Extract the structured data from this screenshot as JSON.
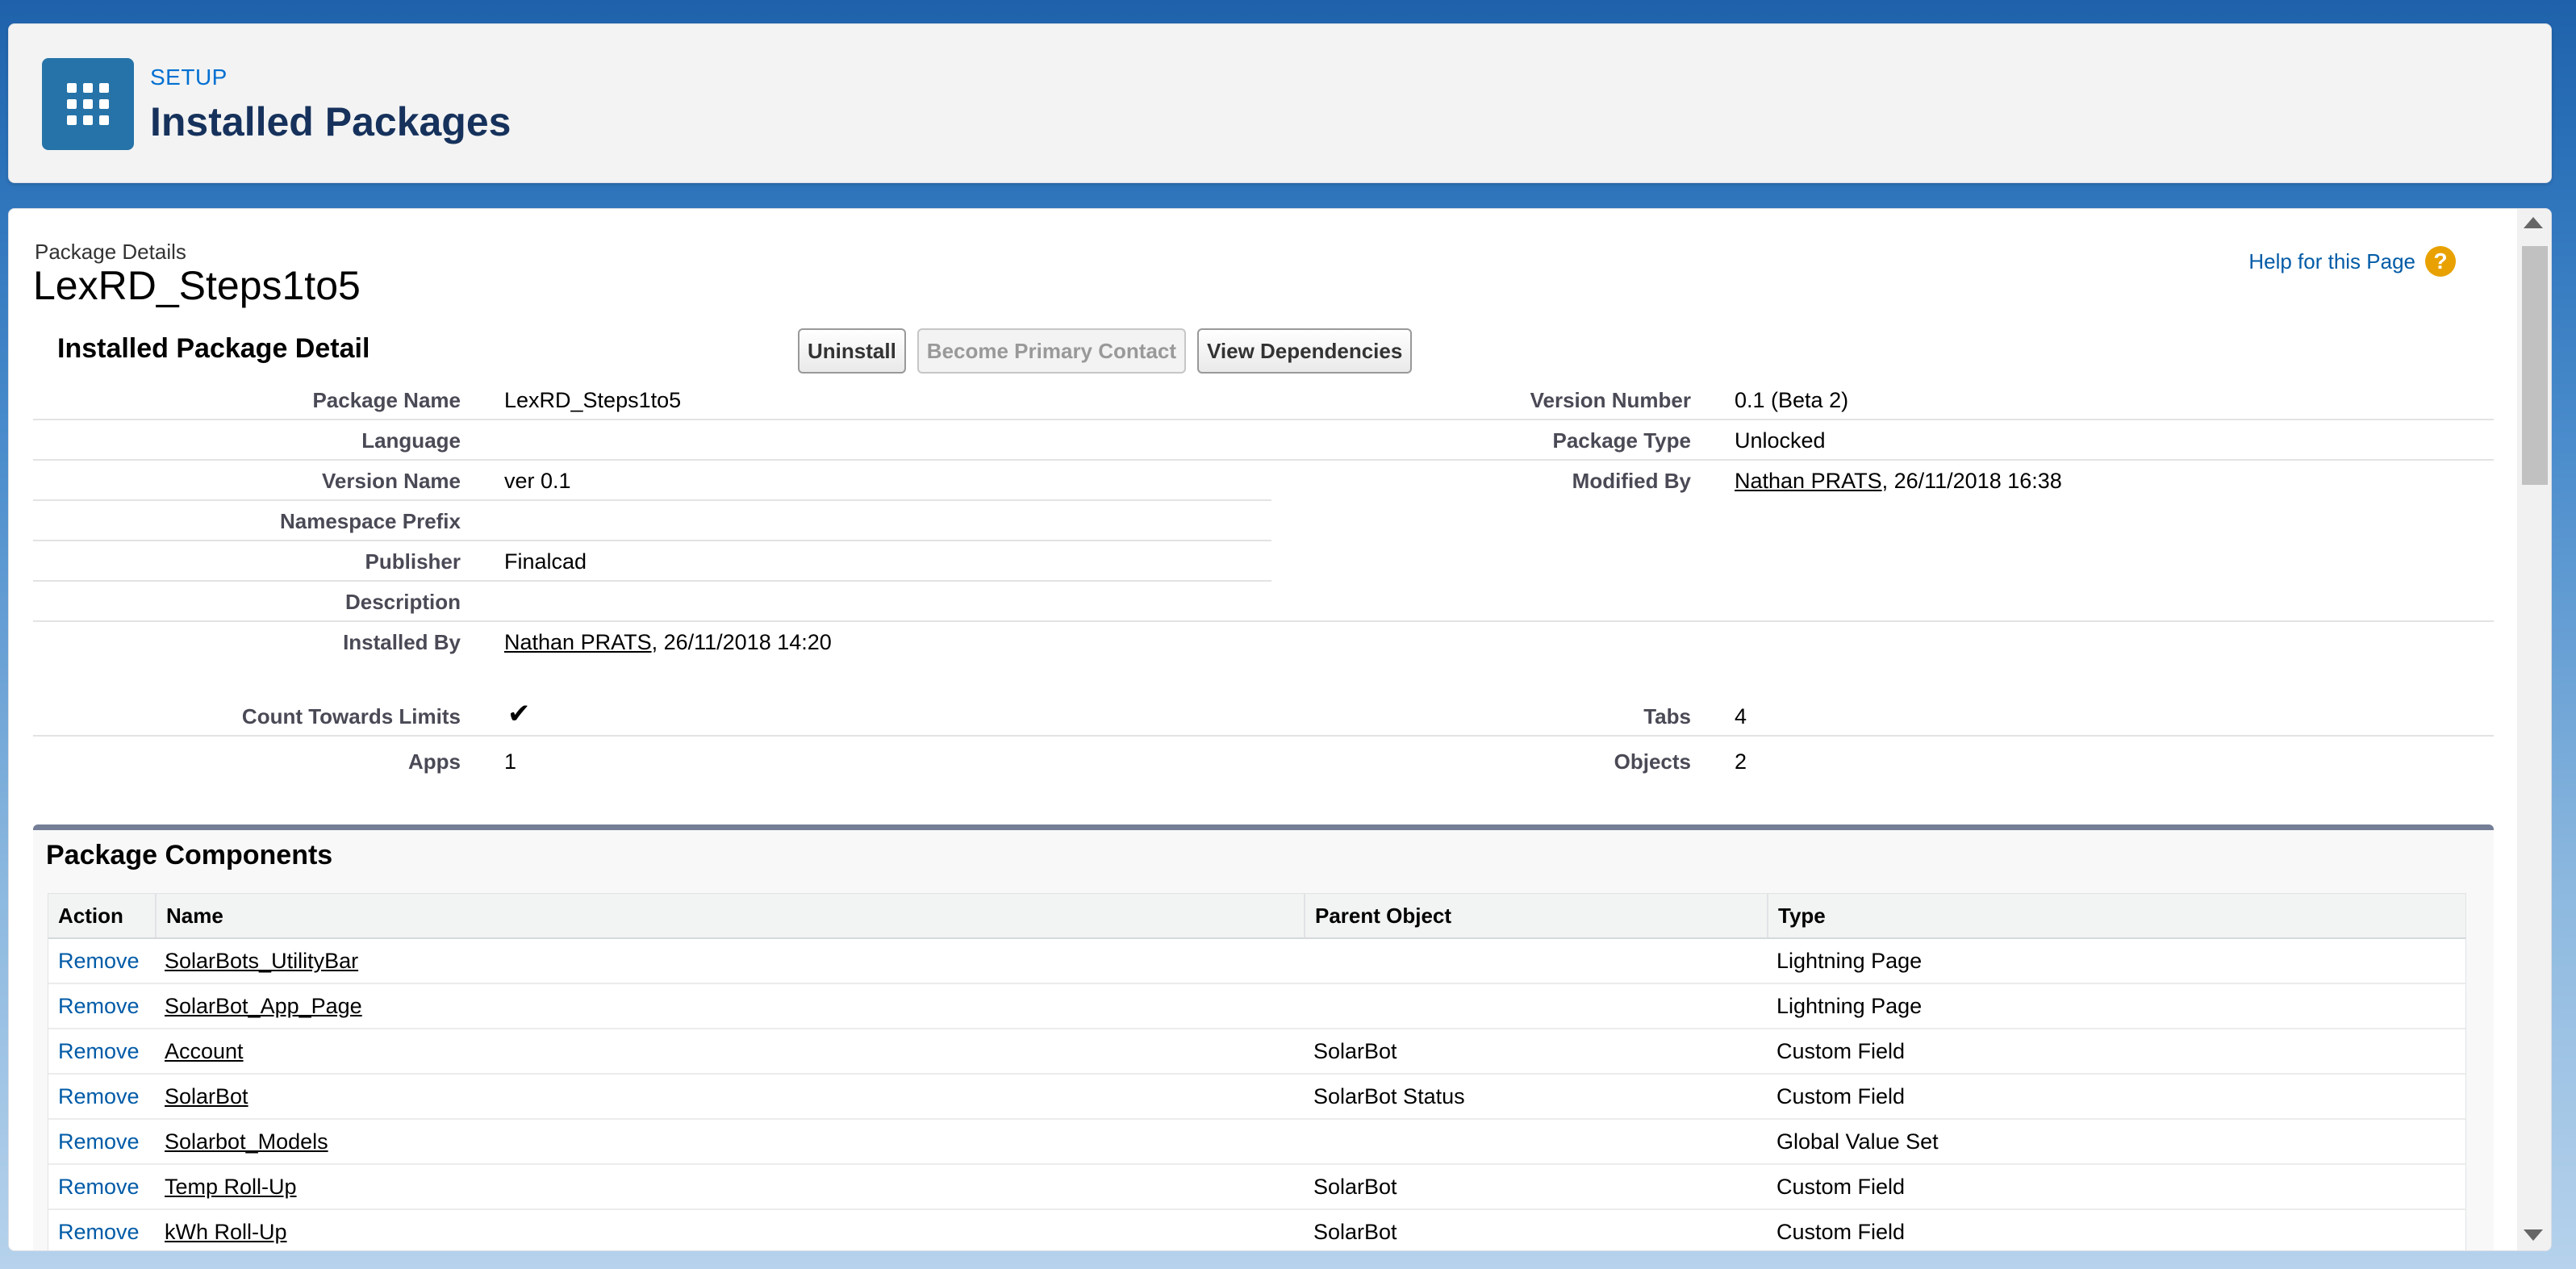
{
  "header": {
    "setup_label": "SETUP",
    "title": "Installed Packages"
  },
  "package": {
    "breadcrumb": "Package Details",
    "name": "LexRD_Steps1to5",
    "help_link": "Help for this Page",
    "section_title": "Installed Package Detail",
    "buttons": {
      "uninstall": "Uninstall",
      "become_primary": "Become Primary Contact",
      "view_dependencies": "View Dependencies"
    },
    "left_fields": [
      {
        "label": "Package Name",
        "value": "LexRD_Steps1to5"
      },
      {
        "label": "Language",
        "value": ""
      },
      {
        "label": "Version Name",
        "value": "ver 0.1"
      },
      {
        "label": "Namespace Prefix",
        "value": ""
      },
      {
        "label": "Publisher",
        "value": "Finalcad"
      },
      {
        "label": "Description",
        "value": ""
      }
    ],
    "installed_by": {
      "label": "Installed By",
      "user": "Nathan PRATS",
      "date": ", 26/11/2018 14:20"
    },
    "right_fields": [
      {
        "label": "Version Number",
        "value": "0.1 (Beta 2)"
      },
      {
        "label": "Package Type",
        "value": "Unlocked"
      }
    ],
    "modified_by": {
      "label": "Modified By",
      "user": "Nathan PRATS",
      "date": ", 26/11/2018 16:38"
    },
    "limits": {
      "count_label": "Count Towards Limits",
      "count_checked": true,
      "apps_label": "Apps",
      "apps_value": "1",
      "tabs_label": "Tabs",
      "tabs_value": "4",
      "objects_label": "Objects",
      "objects_value": "2"
    }
  },
  "components": {
    "title": "Package Components",
    "columns": [
      "Action",
      "Name",
      "Parent Object",
      "Type"
    ],
    "rows": [
      {
        "action": "Remove",
        "name": "SolarBots_UtilityBar",
        "parent": "",
        "type": "Lightning Page"
      },
      {
        "action": "Remove",
        "name": "SolarBot_App_Page",
        "parent": "",
        "type": "Lightning Page"
      },
      {
        "action": "Remove",
        "name": "Account",
        "parent": "SolarBot",
        "type": "Custom Field"
      },
      {
        "action": "Remove",
        "name": "SolarBot",
        "parent": "SolarBot Status",
        "type": "Custom Field"
      },
      {
        "action": "Remove",
        "name": "Solarbot_Models",
        "parent": "",
        "type": "Global Value Set"
      },
      {
        "action": "Remove",
        "name": "Temp Roll-Up",
        "parent": "SolarBot",
        "type": "Custom Field"
      },
      {
        "action": "Remove",
        "name": "kWh Roll-Up",
        "parent": "SolarBot",
        "type": "Custom Field"
      }
    ]
  },
  "colors": {
    "accent": "#0070d2",
    "icon_bg": "#2573a8",
    "help_icon": "#e8a100"
  },
  "icons": {
    "app": "app-launcher-grid-icon",
    "help": "question-mark-icon",
    "check": "checkmark-icon"
  }
}
